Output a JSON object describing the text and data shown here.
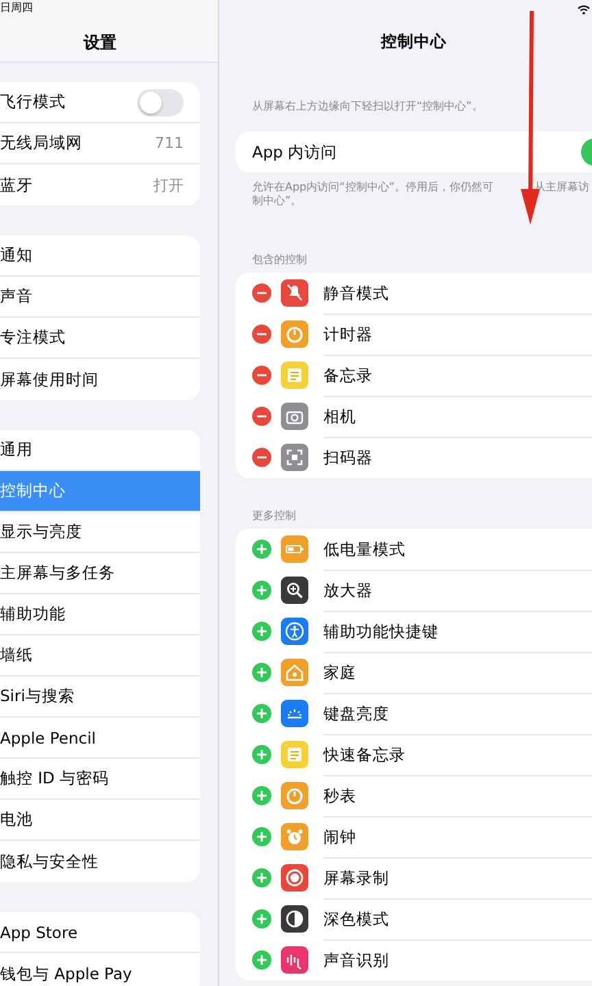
{
  "status_bar": {
    "date": "日周四"
  },
  "sidebar": {
    "title": "设置",
    "groups": [
      [
        {
          "label": "飞行模式",
          "kind": "toggle",
          "on": false
        },
        {
          "label": "无线局域网",
          "kind": "value",
          "value": "711"
        },
        {
          "label": "蓝牙",
          "kind": "value",
          "value": "打开"
        }
      ],
      [
        {
          "label": "通知",
          "selected": false
        },
        {
          "label": "声音",
          "selected": false
        },
        {
          "label": "专注模式",
          "selected": false
        },
        {
          "label": "屏幕使用时间",
          "selected": false
        }
      ],
      [
        {
          "label": "通用",
          "selected": false
        },
        {
          "label": "控制中心",
          "selected": true
        },
        {
          "label": "显示与亮度",
          "selected": false
        },
        {
          "label": "主屏幕与多任务",
          "selected": false
        },
        {
          "label": "辅助功能",
          "selected": false
        },
        {
          "label": "墙纸",
          "selected": false
        },
        {
          "label": "Siri与搜索",
          "selected": false
        },
        {
          "label": "Apple Pencil",
          "selected": false
        },
        {
          "label": "触控 ID 与密码",
          "selected": false
        },
        {
          "label": "电池",
          "selected": false
        },
        {
          "label": "隐私与安全性",
          "selected": false
        }
      ],
      [
        {
          "label": "App Store",
          "selected": false
        },
        {
          "label": "钱包与 Apple Pay",
          "selected": false
        }
      ]
    ]
  },
  "detail": {
    "title": "控制中心",
    "description": "从屏幕右上方边缘向下轻扫以打开“控制中心”。",
    "access": {
      "label": "App 内访问",
      "on": true
    },
    "access_note": [
      "允许在App内访问“控制中心”。停用后，你仍然可",
      "从主屏幕访",
      "制中心”。"
    ],
    "included": {
      "header": "包含的控制",
      "items": [
        {
          "label": "静音模式",
          "color": "#e8473b"
        },
        {
          "label": "计时器",
          "color": "#f0a02a"
        },
        {
          "label": "备忘录",
          "color": "#f5d038"
        },
        {
          "label": "相机",
          "color": "#8e8e93"
        },
        {
          "label": "扫码器",
          "color": "#8e8e93"
        }
      ]
    },
    "more": {
      "header": "更多控制",
      "items": [
        {
          "label": "低电量模式",
          "color": "#f0a02a"
        },
        {
          "label": "放大器",
          "color": "#3a3a3c"
        },
        {
          "label": "辅助功能快捷键",
          "color": "#1a7cf0"
        },
        {
          "label": "家庭",
          "color": "#f0a02a"
        },
        {
          "label": "键盘亮度",
          "color": "#1a7cf0"
        },
        {
          "label": "快速备忘录",
          "color": "#f5d038"
        },
        {
          "label": "秒表",
          "color": "#f0a02a"
        },
        {
          "label": "闹钟",
          "color": "#f0a02a"
        },
        {
          "label": "屏幕录制",
          "color": "#e8473b"
        },
        {
          "label": "深色模式",
          "color": "#3a3a3c"
        },
        {
          "label": "声音识别",
          "color": "#e8356a"
        }
      ]
    }
  }
}
